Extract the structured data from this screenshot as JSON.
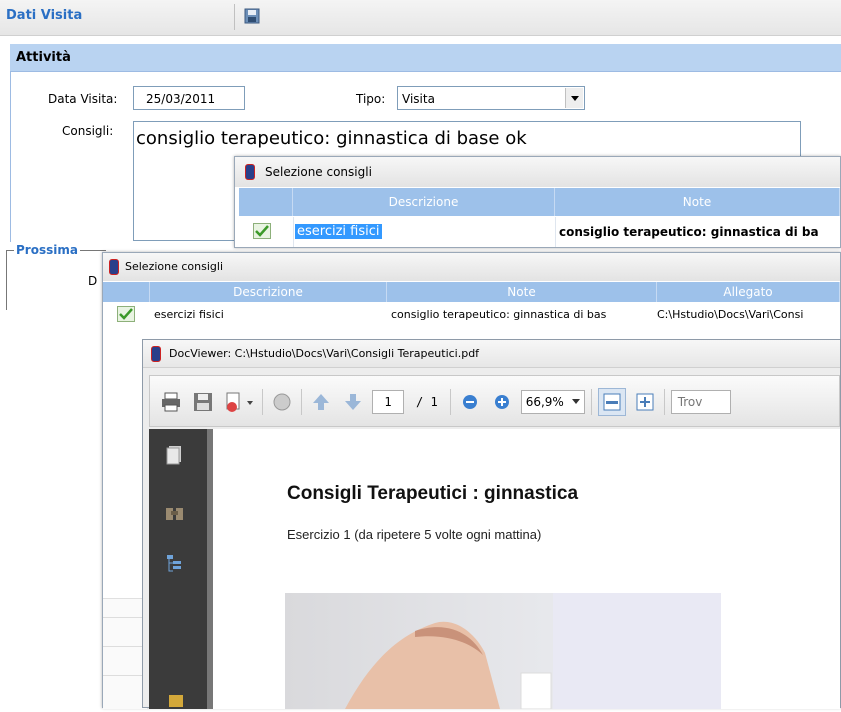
{
  "header": {
    "title": "Dati Visita"
  },
  "section": {
    "title": "Attività"
  },
  "form": {
    "data_label": "Data Visita:",
    "data_value": "25/03/2011",
    "tipo_label": "Tipo:",
    "tipo_value": "Visita",
    "consigli_label": "Consigli:",
    "consigli_value": "consiglio terapeutico: ginnastica di base ok",
    "prossima_label": "Prossima",
    "d_label": "D"
  },
  "dialog1": {
    "title": "Selezione consigli",
    "columns": [
      "Descrizione",
      "Note"
    ],
    "row": {
      "descrizione": "esercizi fisici",
      "note": "consiglio terapeutico: ginnastica di ba"
    }
  },
  "dialog2": {
    "title": "Selezione consigli",
    "columns": [
      "Descrizione",
      "Note",
      "Allegato"
    ],
    "row": {
      "descrizione": "esercizi fisici",
      "note": "consiglio terapeutico: ginnastica di bas",
      "allegato": "C:\\Hstudio\\Docs\\Vari\\Consi"
    }
  },
  "docviewer": {
    "title": "DocViewer: C:\\Hstudio\\Docs\\Vari\\Consigli Terapeutici.pdf",
    "page_current": "1",
    "page_total": "/ 1",
    "zoom": "66,9%",
    "find_label": "Trov",
    "doc_title": "Consigli Terapeutici : ginnastica",
    "doc_text": "Esercizio 1 (da ripetere 5 volte ogni mattina)"
  },
  "colors": {
    "accent": "#2a6fc4",
    "grid_header": "#9dc1ea",
    "selection": "#3399ff",
    "viewer_dark": "#3b3b3b"
  }
}
